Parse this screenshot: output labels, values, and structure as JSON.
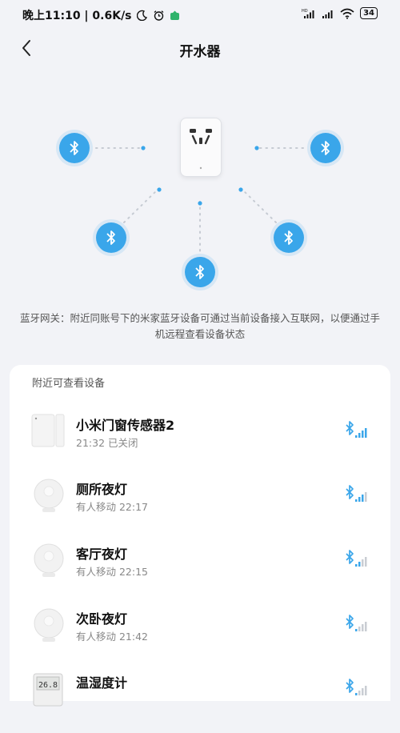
{
  "status_bar": {
    "left_text": "晚上11:10 | 0.6K/s",
    "battery": "34"
  },
  "header": {
    "title": "开水器"
  },
  "description": "蓝牙网关：附近同账号下的米家蓝牙设备可通过当前设备接入互联网，以便通过手机远程查看设备状态",
  "nearby": {
    "section_title": "附近可查看设备",
    "devices": [
      {
        "name": "小米门窗传感器2",
        "status": "21:32 已关闭",
        "icon": "door-window-sensor-icon"
      },
      {
        "name": "厕所夜灯",
        "status": "有人移动 22:17",
        "icon": "night-light-icon"
      },
      {
        "name": "客厅夜灯",
        "status": "有人移动 22:15",
        "icon": "night-light-icon"
      },
      {
        "name": "次卧夜灯",
        "status": "有人移动 21:42",
        "icon": "night-light-icon"
      },
      {
        "name": "温湿度计",
        "status": "",
        "icon": "thermometer-icon",
        "display_text": "26.8"
      }
    ]
  },
  "colors": {
    "accent": "#3aa6ea",
    "background": "#f2f3f7"
  }
}
